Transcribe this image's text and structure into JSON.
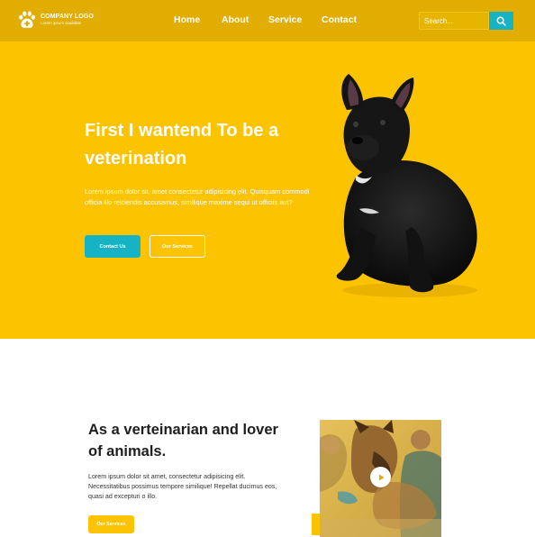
{
  "header": {
    "logo": {
      "name": "COMPANY LOGO",
      "tagline": "Lorem ipsum available"
    },
    "nav": [
      "Home",
      "About",
      "Service",
      "Contact"
    ],
    "search": {
      "placeholder": "Search..."
    }
  },
  "hero": {
    "title_line1": "First I wantend To be a",
    "title_line2": "veterination",
    "paragraph": "Lorem ipsum dolor sit, amet consectetur adipisicing elit. Quisquam commodi officia illo reiciendis accusamus, similique maxime sequi ut officiis aut?",
    "primary_button": "Contact Us",
    "secondary_button": "Our Services"
  },
  "about": {
    "title_line1": "As a verteinarian and lover",
    "title_line2": "of animals.",
    "paragraph": "Lorem ipsum dolor sit amet, consectetur adipisicing elit. Necessitatibus possimus tempore similique! Repellat ducimus eos, quasi ad excepturi o illo.",
    "button": "Our Services"
  },
  "icons": {
    "logo": "paw-plus-icon",
    "search": "search-icon",
    "play": "play-icon"
  },
  "colors": {
    "header": "#e0ad00",
    "hero": "#fcc300",
    "accent": "#15b3c4",
    "text_dark": "#1e1e1e"
  }
}
